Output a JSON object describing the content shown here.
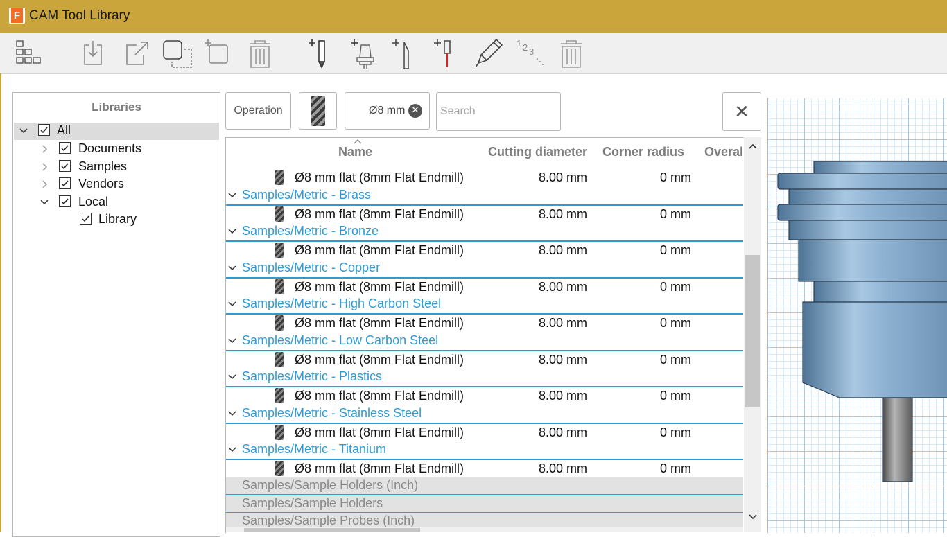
{
  "window": {
    "title": "CAM Tool Library",
    "logo_letter": "F"
  },
  "toolbar": {
    "icons": [
      "library-tree-icon",
      "import-icon",
      "export-icon",
      "duplicate-library-icon",
      "new-library-icon",
      "delete-library-icon",
      "new-mill-tool-icon",
      "new-holder-icon",
      "new-turning-tool-icon",
      "new-probe-icon",
      "edit-tool-icon",
      "renumber-icon",
      "delete-tool-icon"
    ]
  },
  "libraries": {
    "header": "Libraries",
    "items": [
      {
        "label": "All",
        "checked": true,
        "expanded": true
      },
      {
        "label": "Documents",
        "checked": true,
        "expanded": false
      },
      {
        "label": "Samples",
        "checked": true,
        "expanded": false
      },
      {
        "label": "Vendors",
        "checked": true,
        "expanded": false
      },
      {
        "label": "Local",
        "checked": true,
        "expanded": true
      },
      {
        "label": "Library",
        "checked": true
      }
    ]
  },
  "filters": {
    "operation_label": "Operation",
    "diameter_chip": "Ø8 mm",
    "search_placeholder": "Search"
  },
  "table": {
    "columns": [
      "Name",
      "Cutting diameter",
      "Corner radius",
      "Overal"
    ],
    "first_tool": {
      "name": "Ø8 mm flat (8mm Flat Endmill)",
      "diameter": "8.00 mm",
      "corner_radius": "0 mm"
    },
    "groups": [
      {
        "label": "Samples/Metric - Brass",
        "tool": {
          "name": "Ø8 mm flat (8mm Flat Endmill)",
          "diameter": "8.00 mm",
          "corner_radius": "0 mm"
        }
      },
      {
        "label": "Samples/Metric - Bronze",
        "tool": {
          "name": "Ø8 mm flat (8mm Flat Endmill)",
          "diameter": "8.00 mm",
          "corner_radius": "0 mm"
        }
      },
      {
        "label": "Samples/Metric - Copper",
        "tool": {
          "name": "Ø8 mm flat (8mm Flat Endmill)",
          "diameter": "8.00 mm",
          "corner_radius": "0 mm"
        }
      },
      {
        "label": "Samples/Metric - High Carbon Steel",
        "tool": {
          "name": "Ø8 mm flat (8mm Flat Endmill)",
          "diameter": "8.00 mm",
          "corner_radius": "0 mm"
        }
      },
      {
        "label": "Samples/Metric - Low Carbon Steel",
        "tool": {
          "name": "Ø8 mm flat (8mm Flat Endmill)",
          "diameter": "8.00 mm",
          "corner_radius": "0 mm"
        }
      },
      {
        "label": "Samples/Metric - Plastics",
        "tool": {
          "name": "Ø8 mm flat (8mm Flat Endmill)",
          "diameter": "8.00 mm",
          "corner_radius": "0 mm"
        }
      },
      {
        "label": "Samples/Metric - Stainless Steel",
        "tool": {
          "name": "Ø8 mm flat (8mm Flat Endmill)",
          "diameter": "8.00 mm",
          "corner_radius": "0 mm"
        }
      },
      {
        "label": "Samples/Metric - Titanium",
        "tool": {
          "name": "Ø8 mm flat (8mm Flat Endmill)",
          "diameter": "8.00 mm",
          "corner_radius": "0 mm"
        }
      }
    ],
    "collapsed_groups": [
      "Samples/Sample Holders (Inch)",
      "Samples/Sample Holders",
      "Samples/Sample Probes (Inch)"
    ]
  },
  "colors": {
    "title_bar": "#c9a53b",
    "group_link": "#2e9bd6",
    "preview_grid": "#9ccaf0",
    "tool_body": "#6f9ec5"
  }
}
